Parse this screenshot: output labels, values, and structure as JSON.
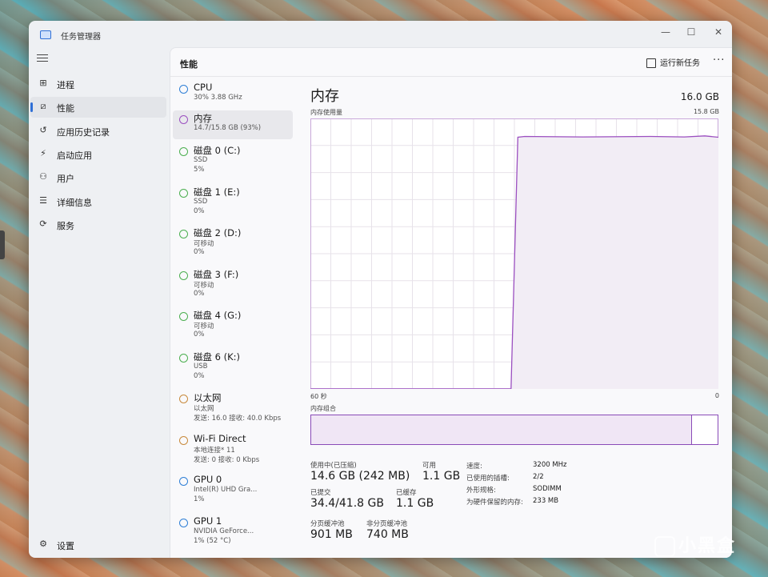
{
  "window": {
    "title": "任务管理器",
    "controls": [
      "—",
      "☐",
      "✕"
    ]
  },
  "nav": {
    "items": [
      {
        "label": "进程",
        "icon": "processes-icon",
        "glyph": "⊞"
      },
      {
        "label": "性能",
        "icon": "performance-icon",
        "glyph": "⧄",
        "active": true
      },
      {
        "label": "应用历史记录",
        "icon": "history-icon",
        "glyph": "↺"
      },
      {
        "label": "启动应用",
        "icon": "startup-icon",
        "glyph": "⚡"
      },
      {
        "label": "用户",
        "icon": "users-icon",
        "glyph": "⚇"
      },
      {
        "label": "详细信息",
        "icon": "details-icon",
        "glyph": "☰"
      },
      {
        "label": "服务",
        "icon": "services-icon",
        "glyph": "⟳"
      }
    ],
    "settings_label": "设置"
  },
  "header": {
    "title": "性能",
    "run_task": "运行新任务",
    "more": "···"
  },
  "perf_list": [
    {
      "name": "CPU",
      "lines": [
        "30% 3.88 GHz"
      ],
      "color": "#2f7fd6"
    },
    {
      "name": "内存",
      "lines": [
        "14.7/15.8 GB (93%)"
      ],
      "color": "#9b4fc0",
      "active": true
    },
    {
      "name": "磁盘 0 (C:)",
      "lines": [
        "SSD",
        "5%"
      ],
      "color": "#4caf50"
    },
    {
      "name": "磁盘 1 (E:)",
      "lines": [
        "SSD",
        "0%"
      ],
      "color": "#4caf50"
    },
    {
      "name": "磁盘 2 (D:)",
      "lines": [
        "可移动",
        "0%"
      ],
      "color": "#4caf50"
    },
    {
      "name": "磁盘 3 (F:)",
      "lines": [
        "可移动",
        "0%"
      ],
      "color": "#4caf50"
    },
    {
      "name": "磁盘 4 (G:)",
      "lines": [
        "可移动",
        "0%"
      ],
      "color": "#4caf50"
    },
    {
      "name": "磁盘 6 (K:)",
      "lines": [
        "USB",
        "0%"
      ],
      "color": "#4caf50"
    },
    {
      "name": "以太网",
      "lines": [
        "以太网",
        "发送: 16.0 接收: 40.0 Kbps"
      ],
      "color": "#c88a3c"
    },
    {
      "name": "Wi-Fi Direct",
      "lines": [
        "本地连接* 11",
        "发送: 0 接收: 0 Kbps"
      ],
      "color": "#c88a3c"
    },
    {
      "name": "GPU 0",
      "lines": [
        "Intel(R) UHD Gra...",
        "1%"
      ],
      "color": "#2f7fd6"
    },
    {
      "name": "GPU 1",
      "lines": [
        "NVIDIA GeForce...",
        "1% (52 °C)"
      ],
      "color": "#2f7fd6"
    }
  ],
  "detail": {
    "title": "内存",
    "capacity": "16.0 GB",
    "usage_label": "内存使用量",
    "usage_max": "15.8 GB",
    "axis_left": "60 秒",
    "axis_right": "0",
    "composition_label": "内存组合",
    "composition_used_fraction": 0.935
  },
  "chart_data": {
    "type": "area",
    "x_label_left": "60 秒",
    "x_label_right": "0",
    "ymax_label": "15.8 GB",
    "ylim": [
      0,
      15.8
    ],
    "x": [
      60,
      30.5,
      29.5,
      28.5,
      20,
      10,
      5,
      2,
      0
    ],
    "y": [
      0,
      0,
      14.7,
      14.75,
      14.72,
      14.75,
      14.72,
      14.78,
      14.7
    ],
    "line_color": "#9b4fc0",
    "fill_color": "#f2edf5"
  },
  "stats": {
    "in_use_label": "使用中(已压缩)",
    "in_use_value": "14.6 GB (242 MB)",
    "available_label": "可用",
    "available_value": "1.1 GB",
    "committed_label": "已提交",
    "committed_value": "34.4/41.8 GB",
    "cached_label": "已缓存",
    "cached_value": "1.1 GB",
    "paged_label": "分页缓冲池",
    "paged_value": "901 MB",
    "nonpaged_label": "非分页缓冲池",
    "nonpaged_value": "740 MB"
  },
  "specs": [
    {
      "label": "速度:",
      "value": "3200 MHz"
    },
    {
      "label": "已使用的插槽:",
      "value": "2/2"
    },
    {
      "label": "外形规格:",
      "value": "SODIMM"
    },
    {
      "label": "为硬件保留的内存:",
      "value": "233 MB"
    }
  ],
  "watermark": "小黑盒"
}
